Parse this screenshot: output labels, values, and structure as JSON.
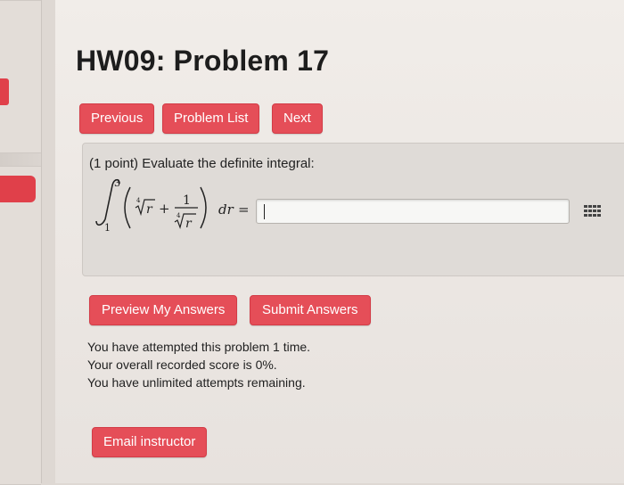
{
  "page": {
    "title": "HW09: Problem 17"
  },
  "nav": {
    "previous": "Previous",
    "problem_list": "Problem List",
    "next": "Next"
  },
  "problem": {
    "prompt": "(1 point) Evaluate the definite integral:",
    "integral": {
      "lower_limit": "1",
      "upper_limit": "3",
      "root_index": "4",
      "radicand": "r",
      "plus": "+",
      "numerator": "1",
      "differential": "dr",
      "equals": "="
    },
    "answer": {
      "value": "",
      "placeholder": ""
    }
  },
  "actions": {
    "preview": "Preview My Answers",
    "submit": "Submit Answers"
  },
  "status": {
    "attempts": "You have attempted this problem 1 time.",
    "score": "Your overall recorded score is 0%.",
    "remaining": "You have unlimited attempts remaining."
  },
  "email_button": "Email instructor",
  "icons": {
    "matrix": "grid-icon"
  },
  "colors": {
    "button_red": "#e54e58",
    "background": "#ebe6e2",
    "panel": "#dfdbd7"
  }
}
